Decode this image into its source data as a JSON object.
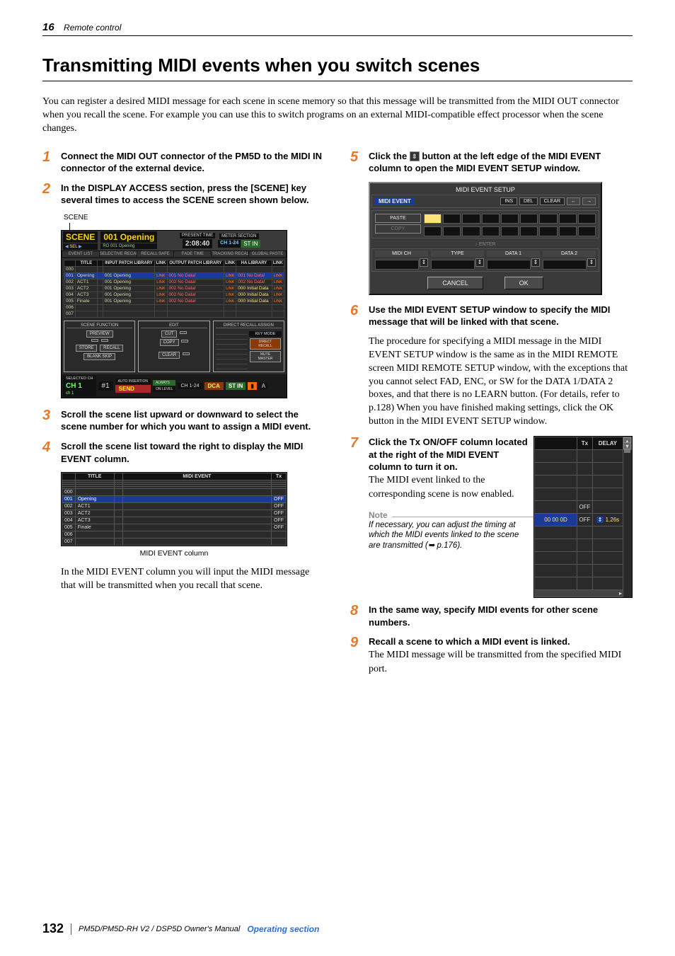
{
  "header": {
    "page_number_top": "16",
    "chapter": "Remote control"
  },
  "title": "Transmitting MIDI events when you switch scenes",
  "intro": "You can register a desired MIDI message for each scene in scene memory so that this message will be transmitted from the MIDI OUT connector when you recall the scene. For example you can use this to switch programs on an external MIDI-compatible effect processor when the scene changes.",
  "steps_left": {
    "s1": "Connect the MIDI OUT connector of the PM5D to the MIDI IN connector of the external device.",
    "s2": "In the DISPLAY ACCESS section, press the [SCENE] key several times to access the SCENE screen shown below.",
    "scene_label": "SCENE",
    "s3": "Scroll the scene list upward or downward to select the scene number for which you want to assign a MIDI event.",
    "s4": "Scroll the scene list toward the right to display the MIDI EVENT column.",
    "midi_caption": "MIDI EVENT column",
    "body4": "In the MIDI EVENT column you will input the MIDI message that will be transmitted when you recall that scene."
  },
  "steps_right": {
    "s5_before": "Click the ",
    "s5_after": " button at the left edge of the MIDI EVENT column to open the MIDI EVENT SETUP window.",
    "s6": "Use the MIDI EVENT SETUP window to specify the MIDI message that will be linked with that scene.",
    "body6": "The procedure for specifying a MIDI message in the MIDI EVENT SETUP window is the same as in the MIDI REMOTE screen MIDI REMOTE SETUP window, with the exceptions that you cannot select FAD, ENC, or SW for the DATA 1/DATA 2 boxes, and that there is no LEARN button. (For details, refer to p.128) When you have finished making settings, click the OK button in the MIDI EVENT SETUP window.",
    "s7": "Click the Tx ON/OFF column located at the right of the MIDI EVENT column to turn it on.",
    "body7": "The MIDI event linked to the corresponding scene is now enabled.",
    "note_title": "Note",
    "note_text": "If necessary, you can adjust the timing at which the MIDI events linked to the scene are transmitted (➥ p.176).",
    "s8": "In the same way, specify MIDI events for other scene numbers.",
    "s9": "Recall a scene to which a MIDI event is linked.",
    "body9": "The MIDI message will be transmitted from the specified MIDI port."
  },
  "scene_screenshot": {
    "title_panel": "SCENE",
    "current_scene": "001 Opening",
    "sub_scene": "RO 001 Opening",
    "present_time_lbl": "PRESENT TIME",
    "present_time": "2:08:40",
    "meter_section_lbl": "METER SECTION",
    "ch_label": "CH 1-24",
    "stin": "ST IN",
    "nav_tabs": [
      "EVENT LIST",
      "SELECTIVE RECALL",
      "RECALL SAFE",
      "FADE TIME",
      "TRACKING RECALL",
      "GLOBAL PASTE"
    ],
    "cols_left": [
      "TITLE"
    ],
    "cols_mid": [
      "INPUT PATCH LIBRARY",
      "LINK",
      "OUTPUT PATCH LIBRARY",
      "LINK"
    ],
    "cols_right": [
      "HA LIBRARY",
      "LINK"
    ],
    "rows": [
      {
        "n": "000",
        "title": "",
        "in": "",
        "ilnk": "",
        "out": "",
        "olnk": "",
        "ha": "",
        "hlnk": ""
      },
      {
        "n": "001",
        "title": "Opening",
        "sel": true,
        "in": "001 Opening",
        "ilnk": "LINK",
        "out": "001",
        "olnk": "No Data!",
        "ollnk": "LINK",
        "ha": "001",
        "hatxt": "No Data!",
        "hlnk": "LINK"
      },
      {
        "n": "002",
        "title": "ACT1",
        "in": "001 Opening",
        "ilnk": "LINK",
        "out": "002",
        "olnk": "No Data!",
        "ollnk": "LINK",
        "ha": "002",
        "hatxt": "No Data!",
        "hlnk": "LINK"
      },
      {
        "n": "003",
        "title": "ACT2",
        "in": "001 Opening",
        "ilnk": "LINK",
        "out": "002",
        "olnk": "No Data!",
        "ollnk": "LINK",
        "ha": "000",
        "hatxt": "Initial Data",
        "hlnk": "LINK"
      },
      {
        "n": "004",
        "title": "ACT3",
        "in": "001 Opening",
        "ilnk": "LINK",
        "out": "002",
        "olnk": "No Data!",
        "ollnk": "LINK",
        "ha": "000",
        "hatxt": "Initial Data",
        "hlnk": "LINK"
      },
      {
        "n": "005",
        "title": "Finale",
        "in": "001 Opening",
        "ilnk": "LINK",
        "out": "002",
        "olnk": "No Data!",
        "ollnk": "LINK",
        "ha": "000",
        "hatxt": "Initial Data",
        "hlnk": "LINK"
      },
      {
        "n": "006",
        "title": "",
        "in": "",
        "ilnk": "",
        "out": "",
        "olnk": "",
        "ha": "",
        "hlnk": ""
      },
      {
        "n": "007",
        "title": "",
        "in": "",
        "ilnk": "",
        "out": "",
        "olnk": "",
        "ha": "",
        "hlnk": ""
      }
    ],
    "scene_function": "SCENE FUNCTION",
    "preview": "PREVIEW",
    "store": "STORE",
    "recall": "RECALL",
    "blank_skip": "BLANK SKIP",
    "edit": "EDIT",
    "cut": "CUT",
    "copy": "COPY",
    "clear": "CLEAR",
    "direct_recall": "DIRECT RECALL ASSIGN",
    "key_mode": "KEY MODE",
    "direct_recall_btn": "DIRECT RECALL",
    "mute_master": "MUTE MASTER",
    "selected_ch": "SELECTED CH",
    "ch_val": "CH 1",
    "ch_sub": "ch 1",
    "assignee": "#1",
    "auto_insertion": "AUTO INSERTION",
    "send": "SEND",
    "always": "ALWAYS",
    "on_level": "ON LEVEL",
    "input_ch": "CH 1-24",
    "dca": "DCA",
    "stin2": "ST IN",
    "letter_a": "A"
  },
  "midi_list_screenshot": {
    "headers": [
      "",
      "TITLE",
      "",
      "MIDI EVENT",
      "Tx"
    ],
    "rows": [
      {
        "n": "000",
        "title": ""
      },
      {
        "n": "001",
        "title": "Opening",
        "sel": true,
        "tx": "OFF"
      },
      {
        "n": "002",
        "title": "ACT1",
        "tx": "OFF"
      },
      {
        "n": "003",
        "title": "ACT2",
        "tx": "OFF"
      },
      {
        "n": "004",
        "title": "ACT3",
        "tx": "OFF"
      },
      {
        "n": "005",
        "title": "Finale",
        "tx": "OFF"
      },
      {
        "n": "006",
        "title": ""
      },
      {
        "n": "007",
        "title": ""
      }
    ]
  },
  "setup_screenshot": {
    "title": "MIDI EVENT SETUP",
    "midi_event": "MIDI EVENT",
    "ins": "INS",
    "del": "DEL",
    "clear": "CLEAR",
    "left": "←",
    "right": "→",
    "paste": "PASTE",
    "copy": "COPY",
    "enter": "ENTER",
    "midi_ch": "MIDI CH",
    "type": "TYPE",
    "data1": "DATA 1",
    "data2": "DATA 2",
    "cancel": "CANCEL",
    "ok": "OK"
  },
  "txdelay_screenshot": {
    "headers": [
      "Tx",
      "DELAY"
    ],
    "rows": [
      {
        "tx": "",
        "delay": ""
      },
      {
        "tx": "",
        "delay": ""
      },
      {
        "tx": "",
        "delay": ""
      },
      {
        "tx": "",
        "delay": ""
      },
      {
        "tx": "OFF",
        "delay": ""
      },
      {
        "tx": "OFF",
        "delay": "1.26s",
        "hex": "00 00 0D",
        "sel": true
      },
      {
        "tx": "",
        "delay": ""
      },
      {
        "tx": "",
        "delay": ""
      },
      {
        "tx": "",
        "delay": ""
      },
      {
        "tx": "",
        "delay": ""
      },
      {
        "tx": "",
        "delay": ""
      }
    ]
  },
  "footer": {
    "page": "132",
    "model": "PM5D/PM5D-RH V2 / DSP5D Owner's Manual",
    "section": "Operating section"
  }
}
